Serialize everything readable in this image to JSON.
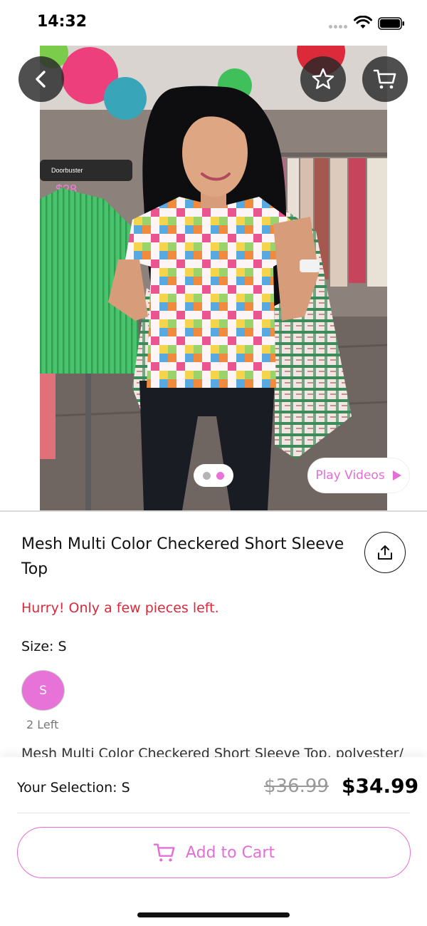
{
  "status_bar": {
    "time": "14:32"
  },
  "hero": {
    "sign_text": "Doorbuster",
    "sign_price": "$28",
    "play_videos_label": "Play Videos",
    "carousel": {
      "total": 2,
      "active_index": 1
    }
  },
  "product": {
    "title": "Mesh Multi Color Checkered Short Sleeve Top",
    "stock_warning": "Hurry! Only a few pieces left.",
    "size_label": "Size: S",
    "size_option": "S",
    "size_stock": "2 Left",
    "description_preview": "Mesh Multi Color Checkered Short Sleeve Top, polyester/"
  },
  "purchase": {
    "selection_label": "Your Selection: S",
    "old_price": "$36.99",
    "current_price": "$34.99",
    "add_to_cart_label": "Add to Cart"
  },
  "icons": {
    "back": "chevron-left-icon",
    "favorite": "star-outline-icon",
    "cart": "cart-icon",
    "share": "share-icon",
    "play": "play-icon"
  },
  "colors": {
    "accent_pink": "#e46dd6",
    "size_selected_fill": "#e873d8",
    "warning_red": "#d62b3c",
    "carousel_dot_inactive": "#b5b5b5",
    "carousel_dot_active": "#e873d8"
  }
}
